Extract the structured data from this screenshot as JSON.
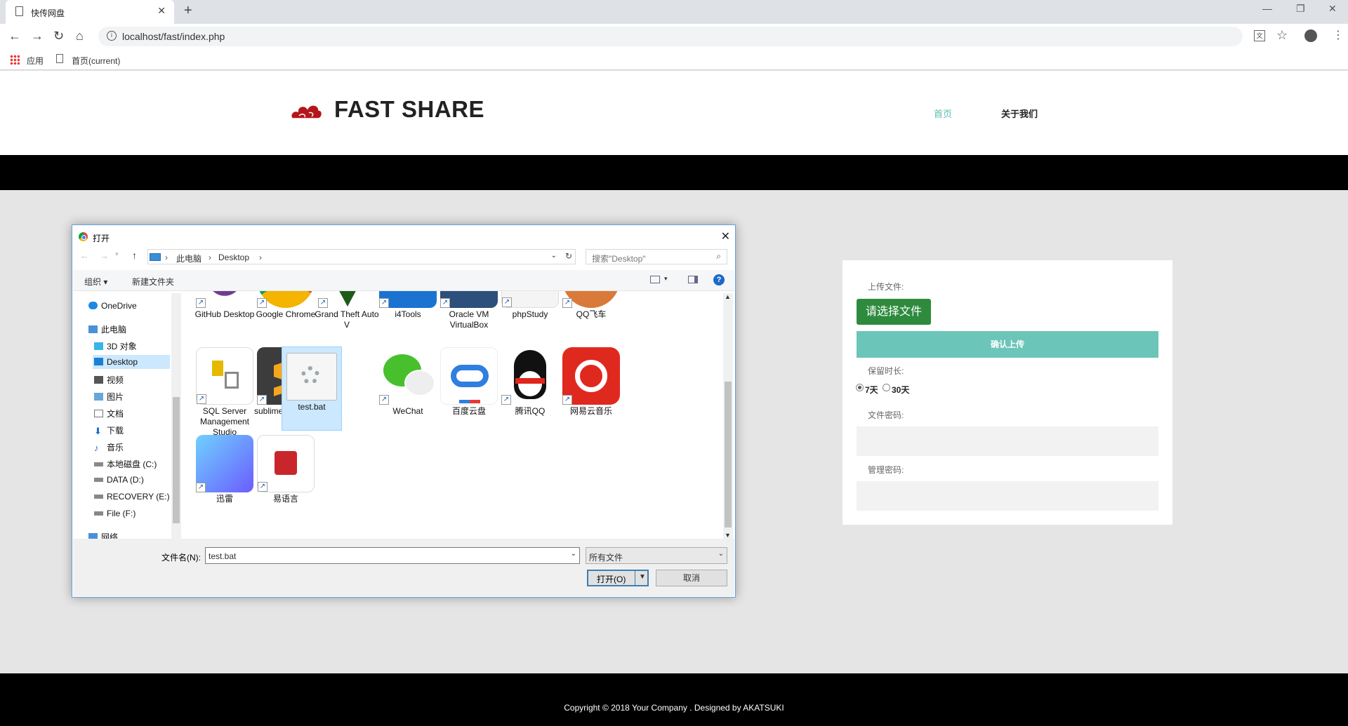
{
  "browser": {
    "tab_title": "快传网盘",
    "url": "localhost/fast/index.php",
    "bookmarks": {
      "apps": "应用",
      "page": "首页(current)"
    }
  },
  "site": {
    "brand": "FAST SHARE",
    "nav": {
      "home": "首页",
      "about": "关于我们"
    },
    "footer": "Copyright © 2018 Your Company . Designed by AKATSUKI"
  },
  "form": {
    "upload_label": "上传文件:",
    "choose_button": "请选择文件",
    "confirm_button": "确认上传",
    "retention_label": "保留时长:",
    "option_7": "7天",
    "option_30": "30天",
    "selected_retention": "7天",
    "file_password_label": "文件密码:",
    "admin_password_label": "管理密码:"
  },
  "dialog": {
    "title": "打开",
    "breadcrumb": [
      "此电脑",
      "Desktop"
    ],
    "search_placeholder": "搜索\"Desktop\"",
    "toolbar": {
      "organize": "组织 ▾",
      "new_folder": "新建文件夹"
    },
    "tree": [
      {
        "label": "OneDrive"
      },
      {
        "label": "此电脑"
      },
      {
        "label": "3D 对象"
      },
      {
        "label": "Desktop",
        "selected": true
      },
      {
        "label": "视频"
      },
      {
        "label": "图片"
      },
      {
        "label": "文档"
      },
      {
        "label": "下载"
      },
      {
        "label": "音乐"
      },
      {
        "label": "本地磁盘 (C:)"
      },
      {
        "label": "DATA (D:)"
      },
      {
        "label": "RECOVERY (E:)"
      },
      {
        "label": "File (F:)"
      },
      {
        "label": "网络"
      }
    ],
    "files_row1": [
      "GitHub Desktop",
      "Google Chrome",
      "Grand Theft Auto V",
      "i4Tools",
      "Oracle VM VirtualBox",
      "phpStudy",
      "QQ飞车"
    ],
    "files_row2": [
      "SQL Server Management Studio",
      "sublime_text.exe",
      "test.bat",
      "WeChat",
      "百度云盘",
      "腾讯QQ",
      "网易云音乐"
    ],
    "files_row3": [
      "迅雷",
      "易语言"
    ],
    "selected_file": "test.bat",
    "filename_label": "文件名(N):",
    "filename_value": "test.bat",
    "filetype_value": "所有文件",
    "open_button": "打开(O)",
    "cancel_button": "取消"
  }
}
